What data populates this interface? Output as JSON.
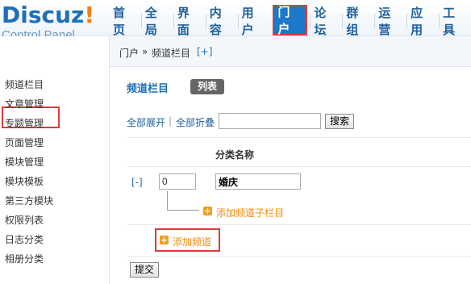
{
  "logo": {
    "title": "Discuz",
    "mark": "!",
    "subtitle": "Control Panel"
  },
  "topnav": [
    "首页",
    "全局",
    "界面",
    "内容",
    "用户",
    "门户",
    "论坛",
    "群组",
    "运营",
    "应用",
    "工具"
  ],
  "topnav_active": "门户",
  "sidebar": {
    "items": [
      "频道栏目",
      "文章管理",
      "专题管理",
      "页面管理",
      "模块管理",
      "模块模板",
      "第三方模块",
      "权限列表",
      "日志分类",
      "相册分类"
    ],
    "active": "频道栏目"
  },
  "breadcrumb": {
    "part1": "门户",
    "sep": "»",
    "part2": "频道栏目",
    "toggle": "[+]"
  },
  "main": {
    "title": "频道栏目",
    "list_button": "列表",
    "expand_all": "全部展开",
    "separator": "|",
    "collapse_all": "全部折叠",
    "search_value": "",
    "search_button": "搜索",
    "column_header": "分类名称",
    "row": {
      "toggle": "[-]",
      "order": "0",
      "name": "婚庆"
    },
    "add_sub_channel": "添加频道子栏目",
    "add_channel": "添加频道",
    "submit": "提交"
  },
  "colors": {
    "brand": "#1f6fb7",
    "accent": "#f47e10",
    "highlight": "#e23a3a",
    "add_link": "#f08c10"
  }
}
